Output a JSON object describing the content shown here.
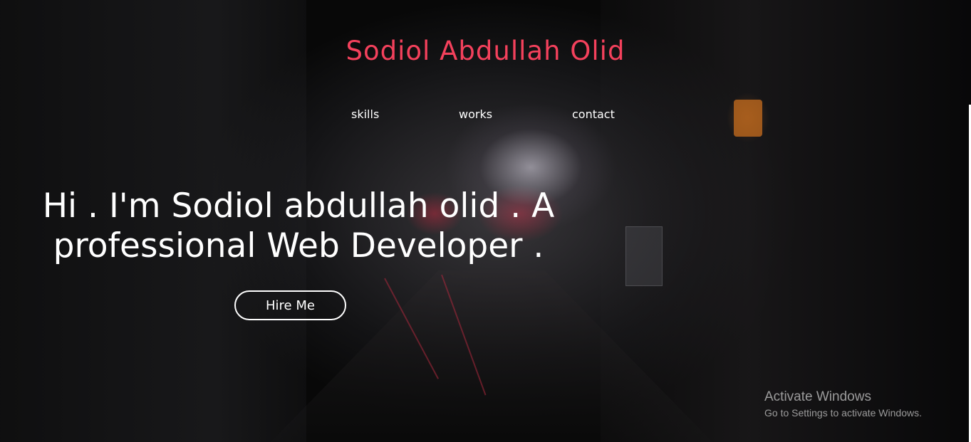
{
  "header": {
    "site_title": "Sodiol Abdullah Olid"
  },
  "nav": {
    "items": [
      {
        "label": "skills"
      },
      {
        "label": "works"
      },
      {
        "label": "contact"
      }
    ]
  },
  "hero": {
    "headline_line1": "Hi . I'm Sodiol abdullah olid . A",
    "headline_line2": "professional Web Developer .",
    "cta_label": "Hire Me"
  },
  "watermark": {
    "title": "Activate Windows",
    "subtitle": "Go to Settings to activate Windows."
  },
  "colors": {
    "accent": "#f4415c",
    "text": "#ffffff",
    "background": "#141416"
  }
}
